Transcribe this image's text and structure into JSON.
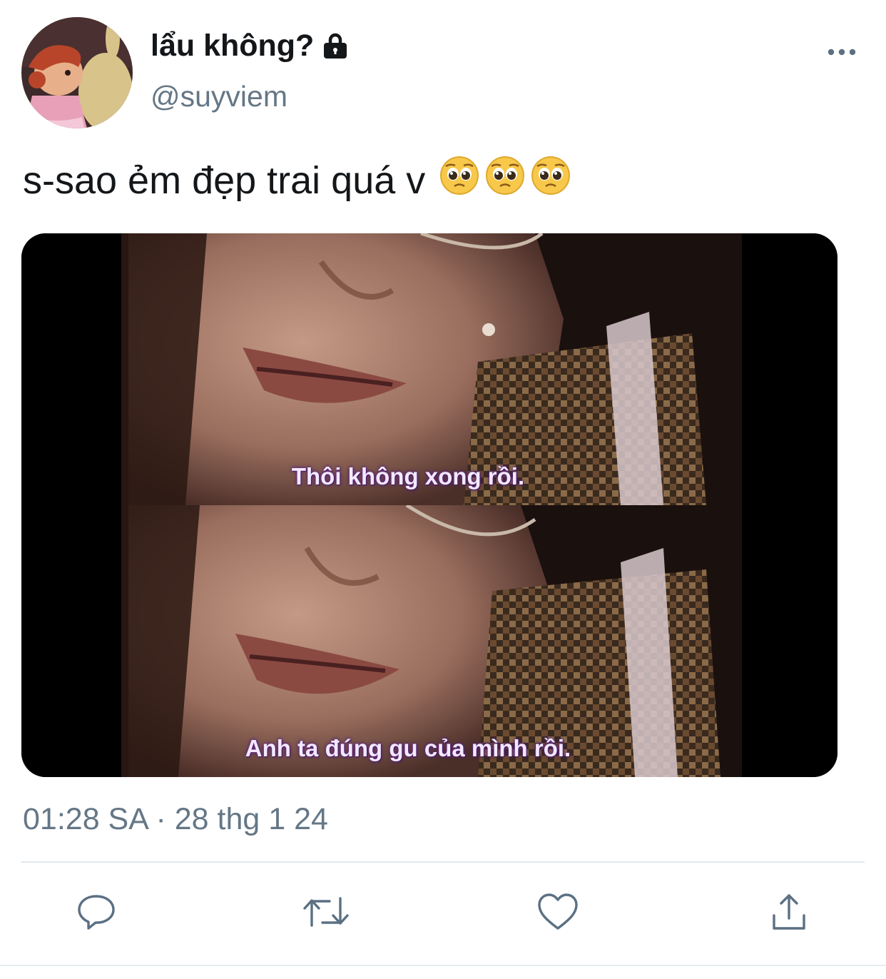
{
  "tweet": {
    "display_name": "lẩu không?",
    "handle": "@suyviem",
    "text": "s-sao ẻm đẹp trai quá v",
    "emojis": [
      "🥺",
      "🥺",
      "🥺"
    ],
    "timestamp": "01:28 SA · 28 thg 1 24"
  },
  "media": {
    "frames": [
      {
        "subtitle": "Thôi không xong rồi."
      },
      {
        "subtitle": "Anh ta đúng gu của mình rồi."
      }
    ]
  },
  "icons": {
    "protected": "lock-icon",
    "more": "more-dots-icon",
    "reply": "reply-icon",
    "retweet": "retweet-icon",
    "like": "heart-icon",
    "share": "share-icon"
  },
  "colors": {
    "text": "#14171a",
    "secondary": "#657786",
    "icon": "#5b7083",
    "divider": "#e1e8ed"
  }
}
